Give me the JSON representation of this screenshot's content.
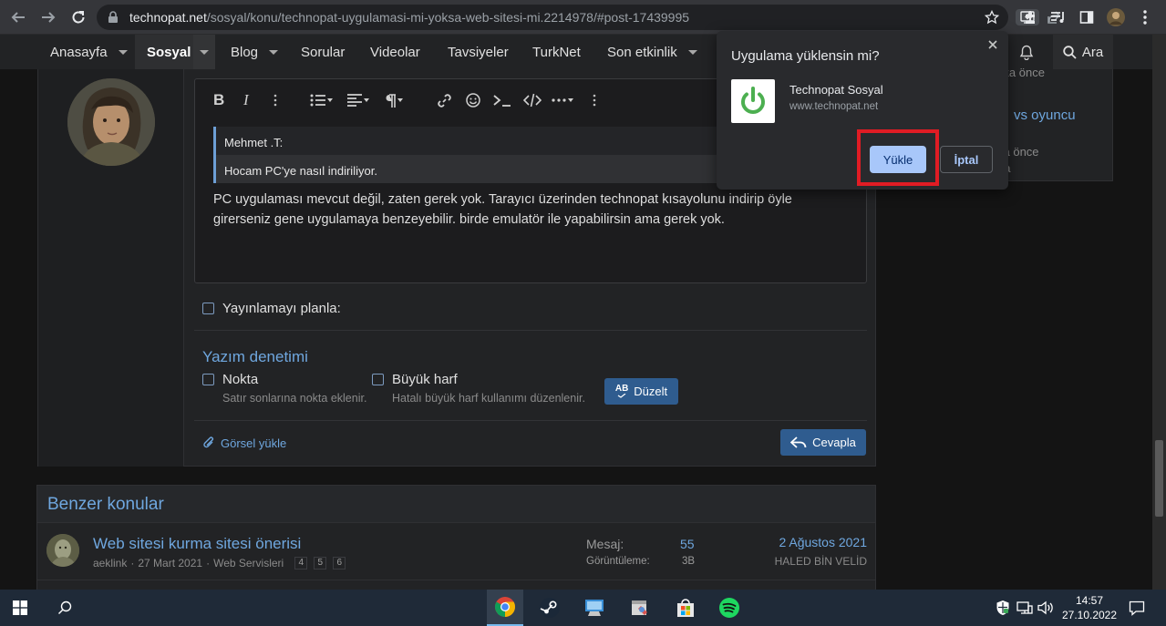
{
  "browser": {
    "url_host": "technopat.net",
    "url_path": "/sosyal/konu/technopat-uygulamasi-mi-yoksa-web-sitesi-mi.2214978/#post-17439995"
  },
  "nav": {
    "items": [
      "Anasayfa",
      "Sosyal",
      "Blog",
      "Sorular",
      "Videolar",
      "Tavsiyeler",
      "TurkNet",
      "Son etkinlik"
    ],
    "search_label": "Ara"
  },
  "editor": {
    "quote_author": "Mehmet .T:",
    "quote_text": "Hocam PC'ye nasıl indiriliyor.",
    "body_line1": "PC uygulaması mevcut değil, zaten gerek yok. Tarayıcı üzerinden technopat kısayolunu indirip öyle",
    "body_line2": "girerseniz gene uygulamaya benzeyebilir. birde emulatör ile yapabilirsin ama gerek yok."
  },
  "form": {
    "schedule_label": "Yayınlamayı planla:",
    "spellcheck_title": "Yazım denetimi",
    "period_label": "Nokta",
    "period_hint": "Satır sonlarına nokta eklenir.",
    "caps_label": "Büyük harf",
    "caps_hint": "Hatalı büyük harf kullanımı düzenlenir.",
    "fix_label": "Düzelt",
    "fix_icon_text": "AB",
    "upload_label": "Görsel yükle",
    "reply_label": "Cevapla"
  },
  "similar": {
    "heading": "Benzer konular",
    "threads": [
      {
        "title": "Web sitesi kurma sitesi önerisi",
        "author": "aeklink",
        "date": "27 Mart 2021",
        "forum": "Web Servisleri",
        "pages": [
          "4",
          "5",
          "6"
        ],
        "replies_label": "Mesaj:",
        "replies": "55",
        "views_label": "Görüntüleme:",
        "views": "3B",
        "last_date": "2 Ağustos 2021",
        "last_user": "HALED BİN VELİD"
      }
    ]
  },
  "sidebar": {
    "line1": "kika önce",
    "link": "vs oyuncu",
    "line2": "ka önce",
    "line3": "na"
  },
  "install_popup": {
    "title": "Uygulama yüklensin mi?",
    "app_name": "Technopat Sosyal",
    "app_url": "www.technopat.net",
    "install_label": "Yükle",
    "cancel_label": "İptal"
  },
  "taskbar": {
    "time": "14:57",
    "date": "27.10.2022"
  },
  "colors": {
    "accent": "#6fa7df",
    "button": "#2f5c8f",
    "highlight_box": "#e01c24",
    "install_button": "#a8c7fa"
  }
}
